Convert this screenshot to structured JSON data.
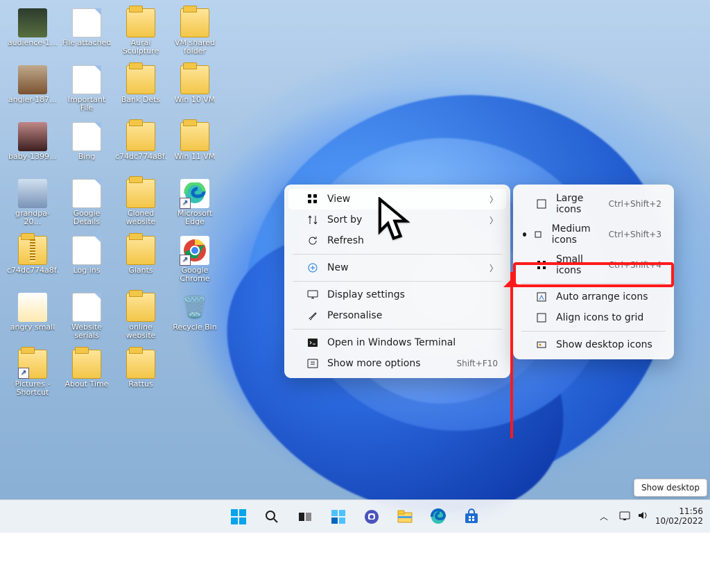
{
  "desktop_icons": [
    {
      "label": "audience-1…",
      "kind": "img"
    },
    {
      "label": "File attached",
      "kind": "doc"
    },
    {
      "label": "Aural Sculpture",
      "kind": "folder"
    },
    {
      "label": "VM shared folder",
      "kind": "folder"
    },
    {
      "label": "angler-187…",
      "kind": "img2"
    },
    {
      "label": "Important File",
      "kind": "doc"
    },
    {
      "label": "Bank Dets",
      "kind": "folder"
    },
    {
      "label": "Win 10 VM",
      "kind": "folder"
    },
    {
      "label": "baby-1399…",
      "kind": "img3"
    },
    {
      "label": "Bing",
      "kind": "doc"
    },
    {
      "label": "c74dc774a8f…",
      "kind": "folder"
    },
    {
      "label": "Win 11 VM",
      "kind": "folder"
    },
    {
      "label": "grandpa-20…",
      "kind": "img4"
    },
    {
      "label": "Google Details",
      "kind": "doc"
    },
    {
      "label": "Cloned website",
      "kind": "folder"
    },
    {
      "label": "Microsoft Edge",
      "kind": "edge",
      "shortcut": true
    },
    {
      "label": "c74dc774a8f…",
      "kind": "zip"
    },
    {
      "label": "Log ins",
      "kind": "doc"
    },
    {
      "label": "Giants",
      "kind": "folder"
    },
    {
      "label": "Google Chrome",
      "kind": "chrome",
      "shortcut": true
    },
    {
      "label": "angry small",
      "kind": "img5"
    },
    {
      "label": "Website serials",
      "kind": "doc"
    },
    {
      "label": "online website",
      "kind": "folder"
    },
    {
      "label": "Recycle Bin",
      "kind": "recycle"
    },
    {
      "label": "Pictures - Shortcut",
      "kind": "folder",
      "shortcut": true
    },
    {
      "label": "About Time",
      "kind": "folder"
    },
    {
      "label": "Rattus",
      "kind": "folder"
    }
  ],
  "context_menu": {
    "items": [
      {
        "icon": "grid",
        "label": "View",
        "submenu": true,
        "hover": true
      },
      {
        "icon": "sort",
        "label": "Sort by",
        "submenu": true
      },
      {
        "icon": "refresh",
        "label": "Refresh"
      },
      {
        "sep": true
      },
      {
        "icon": "plus",
        "label": "New",
        "submenu": true
      },
      {
        "sep": true
      },
      {
        "icon": "display",
        "label": "Display settings"
      },
      {
        "icon": "brush",
        "label": "Personalise"
      },
      {
        "sep": true
      },
      {
        "icon": "terminal",
        "label": "Open in Windows Terminal"
      },
      {
        "icon": "more",
        "label": "Show more options",
        "shortcut": "Shift+F10"
      }
    ]
  },
  "view_submenu": {
    "items": [
      {
        "icon": "large",
        "label": "Large icons",
        "shortcut": "Ctrl+Shift+2"
      },
      {
        "icon": "medium",
        "label": "Medium icons",
        "shortcut": "Ctrl+Shift+3",
        "selected": true
      },
      {
        "icon": "small",
        "label": "Small icons",
        "shortcut": "Ctrl+Shift+4"
      },
      {
        "sep": true
      },
      {
        "icon": "auto",
        "label": "Auto arrange icons",
        "highlight": true
      },
      {
        "icon": "align",
        "label": "Align icons to grid"
      },
      {
        "sep": true
      },
      {
        "icon": "show",
        "label": "Show desktop icons"
      }
    ]
  },
  "taskbar": {
    "pinned": [
      "start",
      "search",
      "taskview",
      "widgets",
      "chat",
      "explorer",
      "edge",
      "store"
    ],
    "system_tray": {
      "chevron": "︿",
      "network": "net",
      "volume": "vol",
      "time": "11:56",
      "date": "10/02/2022"
    },
    "show_desktop_tooltip": "Show desktop"
  }
}
